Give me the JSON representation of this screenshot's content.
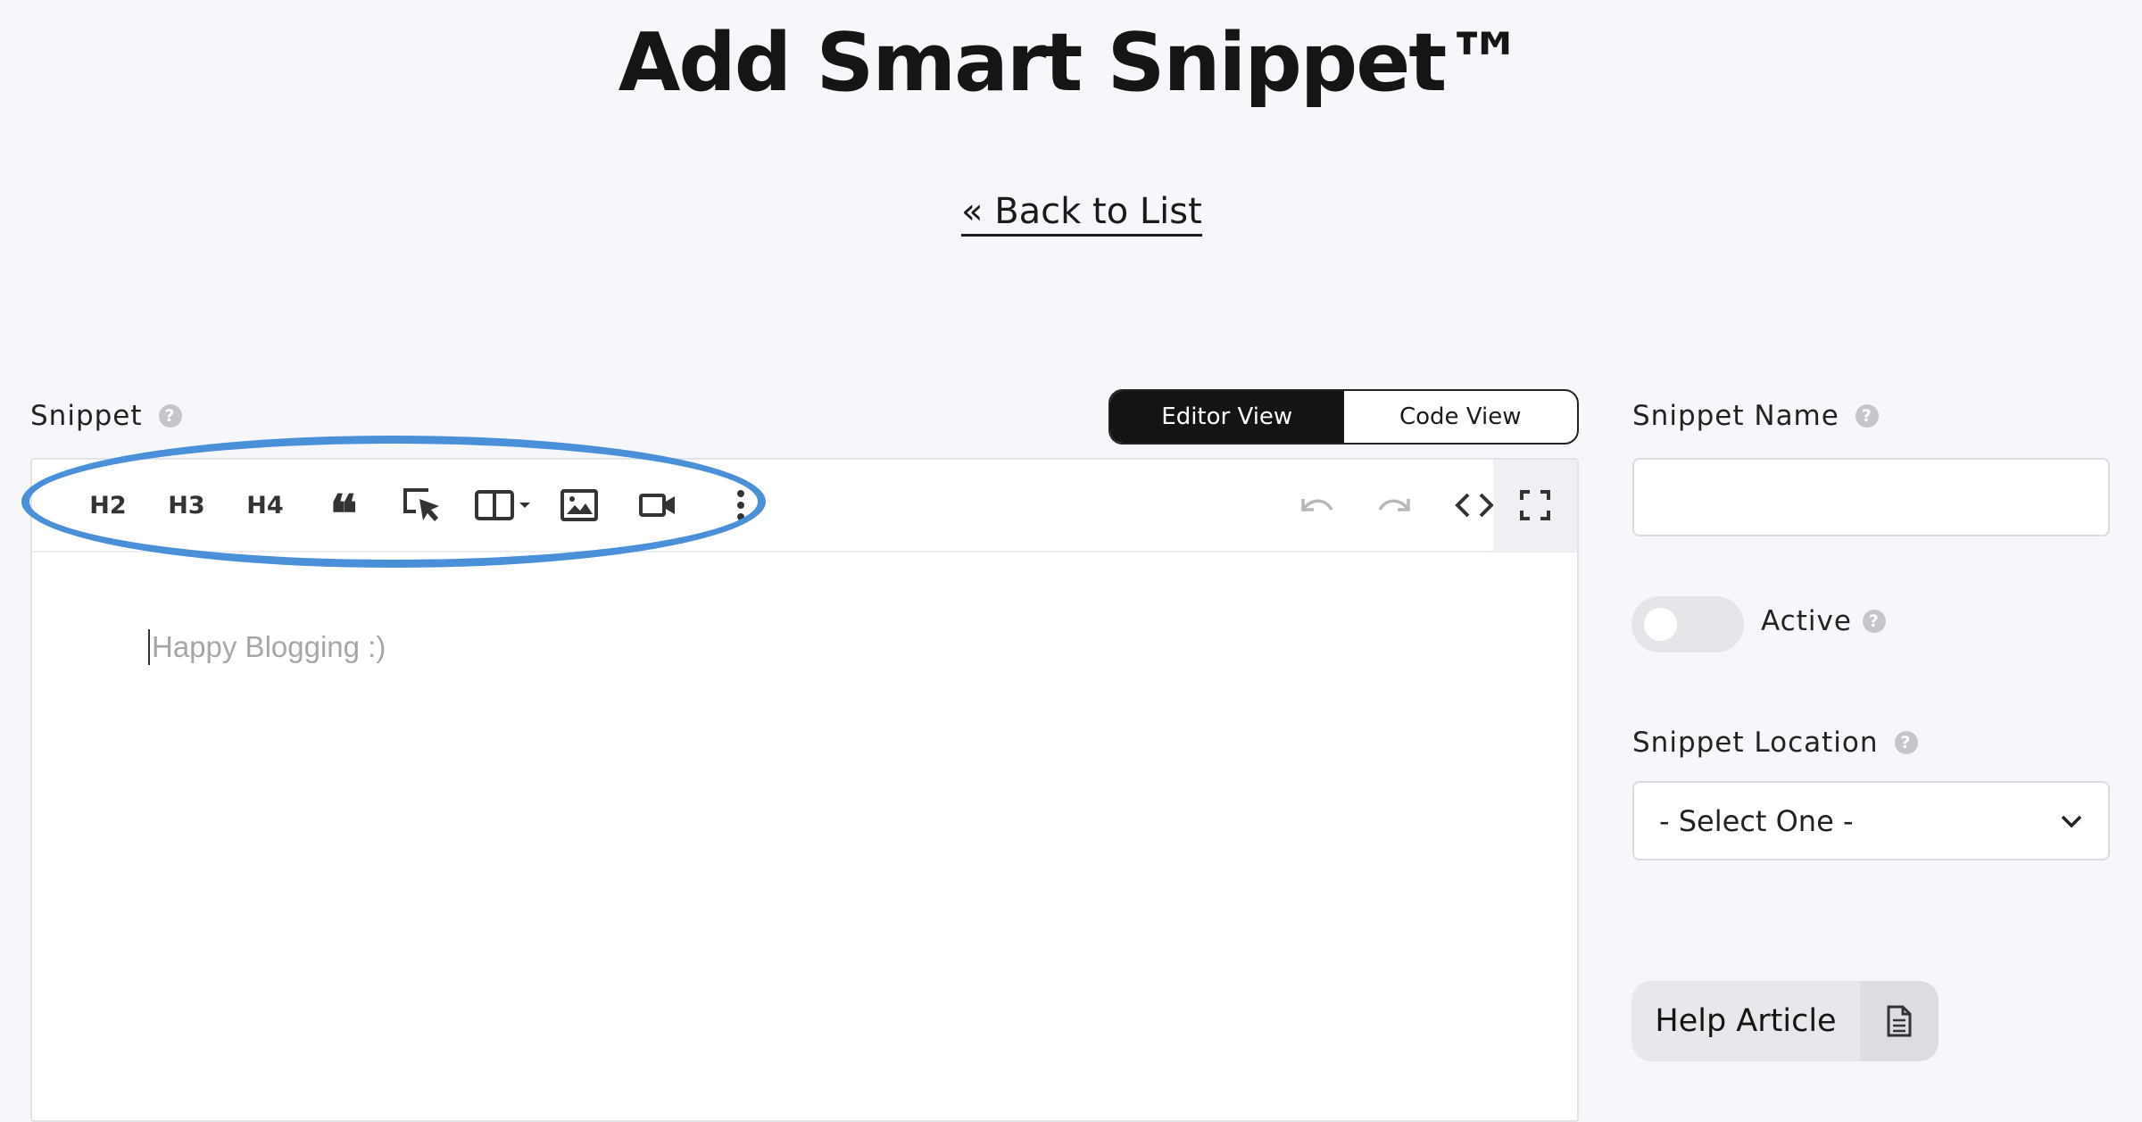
{
  "header": {
    "title": "Add Smart Snippet™",
    "back_link": "« Back to List"
  },
  "snippet": {
    "label": "Snippet",
    "help": "?",
    "view_toggle": {
      "editor": "Editor View",
      "code": "Code View",
      "selected": "Editor View"
    },
    "toolbar": {
      "h2": "H2",
      "h3": "H3",
      "h4": "H4"
    },
    "placeholder": "Happy Blogging :)"
  },
  "sidebar": {
    "name_label": "Snippet Name",
    "name_value": "",
    "active_label": "Active",
    "active_on": false,
    "location_label": "Snippet Location",
    "location_value": "- Select One -",
    "help_article": "Help Article"
  },
  "colors": {
    "highlight": "#4a90d9",
    "toggle_active": "#141414"
  },
  "icons": [
    "quote-icon",
    "cursor-select-icon",
    "layout-columns-icon",
    "image-icon",
    "video-icon",
    "more-vertical-icon",
    "undo-icon",
    "redo-icon",
    "code-icon",
    "fullscreen-icon",
    "help-circle-icon",
    "chevron-down-icon",
    "document-icon"
  ]
}
